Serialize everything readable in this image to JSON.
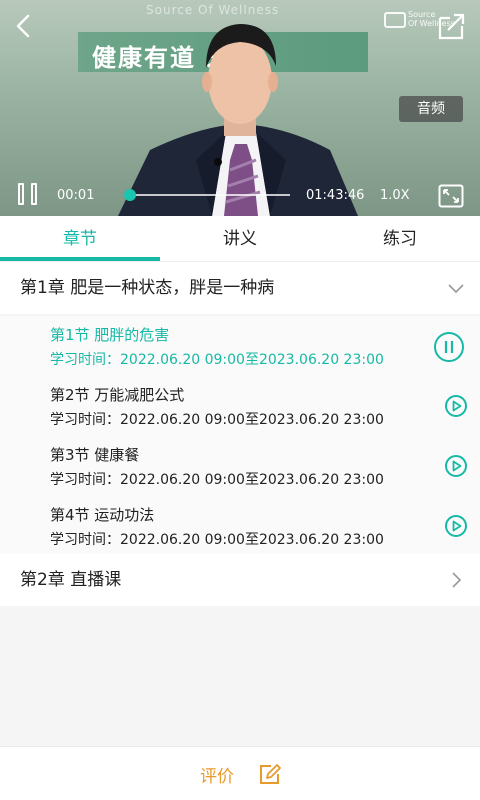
{
  "video": {
    "brand_caption": "Source Of Wellness",
    "banner_text": "健康有道 未来",
    "logo_text": "Source\nOf Wellness",
    "audio_label": "音频",
    "current_time": "00:01",
    "total_time": "01:43:46",
    "speed": "1.0X",
    "progress": 0.0
  },
  "tabs": [
    {
      "label": "章节",
      "active": true
    },
    {
      "label": "讲义",
      "active": false
    },
    {
      "label": "练习",
      "active": false
    }
  ],
  "chapters": [
    {
      "title": "第1章 肥是一种状态，胖是一种病",
      "expanded": true,
      "lessons": [
        {
          "title": "第1节 肥胖的危害",
          "time": "学习时间：2022.06.20 09:00至2023.06.20 23:00",
          "state": "playing"
        },
        {
          "title": "第2节 万能减肥公式",
          "time": "学习时间：2022.06.20 09:00至2023.06.20 23:00",
          "state": "idle"
        },
        {
          "title": "第3节 健康餐",
          "time": "学习时间：2022.06.20 09:00至2023.06.20 23:00",
          "state": "idle"
        },
        {
          "title": "第4节 运动功法",
          "time": "学习时间：2022.06.20 09:00至2023.06.20 23:00",
          "state": "idle"
        }
      ]
    },
    {
      "title": "第2章 直播课",
      "expanded": false
    }
  ],
  "footer": {
    "review_label": "评价"
  },
  "colors": {
    "accent": "#16b9a5",
    "review": "#e89b2c"
  },
  "icons": [
    "back-arrow-icon",
    "share-icon",
    "pause-icon",
    "fullscreen-icon",
    "chevron-down-icon",
    "chevron-right-icon",
    "play-circle-icon",
    "pause-circle-icon",
    "edit-icon"
  ]
}
